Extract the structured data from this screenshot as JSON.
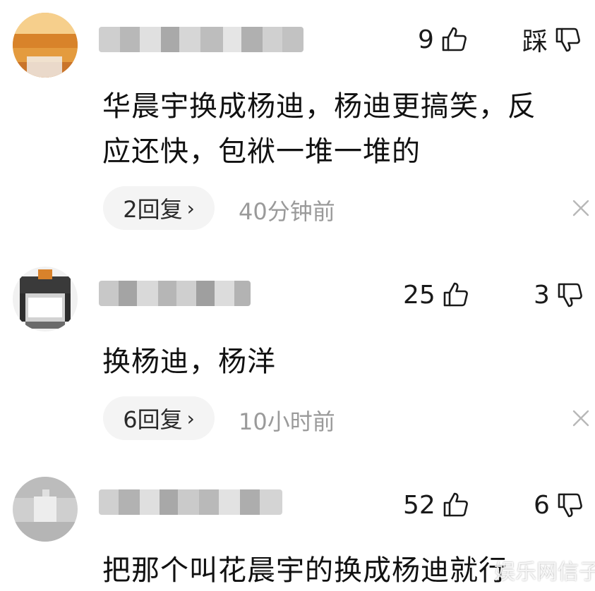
{
  "comments": [
    {
      "likes": "9",
      "dislike_label": "踩",
      "text_lines": [
        "华晨宇换成杨迪，杨迪更搞笑，反",
        "应还快，包袱一堆一堆的"
      ],
      "replies": "2回复",
      "time": "40分钟前",
      "avatar_icon": "blurred-avatar-orange"
    },
    {
      "likes": "25",
      "dislike_label": "3",
      "text_lines": [
        "换杨迪，杨洋"
      ],
      "replies": "6回复",
      "time": "10小时前",
      "avatar_icon": "blurred-avatar-cat"
    },
    {
      "likes": "52",
      "dislike_label": "6",
      "text_lines": [
        "把那个叫花晨宇的换成杨迪就行"
      ],
      "avatar_icon": "blurred-avatar-gray"
    }
  ],
  "reply_chevron": "›",
  "watermark": "娱乐网信子",
  "icons": {
    "like": "thumbs-up-icon",
    "dislike": "thumbs-down-icon",
    "close": "close-icon"
  },
  "colors": {
    "text": "#111111",
    "muted": "#9a9a9a",
    "pill_bg": "#f4f4f4"
  }
}
